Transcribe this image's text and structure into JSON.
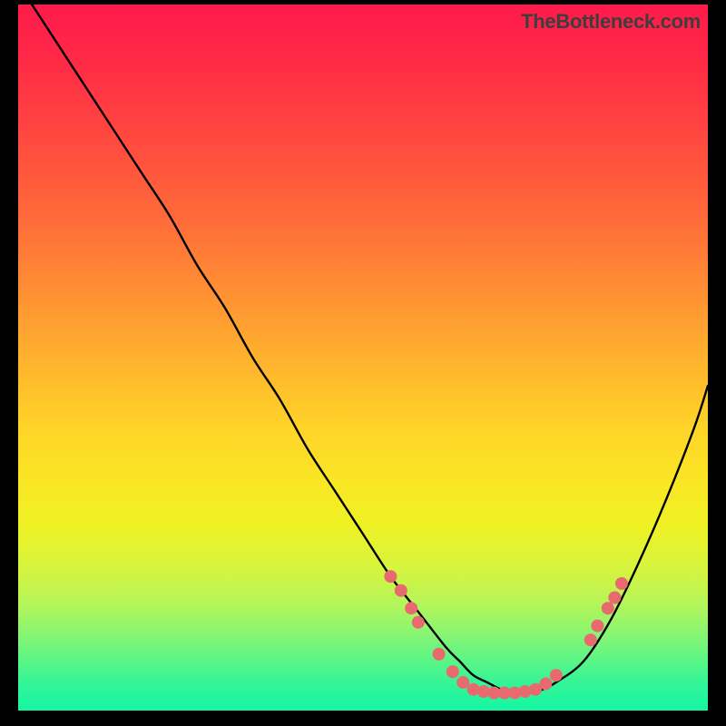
{
  "watermark": "TheBottleneck.com",
  "chart_data": {
    "type": "line",
    "title": "",
    "xlabel": "",
    "ylabel": "",
    "xlim": [
      0,
      100
    ],
    "ylim": [
      0,
      100
    ],
    "series": [
      {
        "name": "curve",
        "x": [
          2,
          6,
          10,
          14,
          18,
          22,
          26,
          30,
          34,
          38,
          42,
          46,
          50,
          54,
          58,
          62,
          64,
          66,
          68,
          70,
          72,
          74,
          76,
          78,
          82,
          86,
          90,
          94,
          98,
          100
        ],
        "y": [
          100,
          94,
          88,
          82,
          76,
          70,
          63,
          57,
          50,
          44,
          37,
          31,
          25,
          19,
          14,
          9,
          7,
          5,
          4,
          3,
          2.5,
          2.5,
          3,
          4,
          7,
          13,
          21,
          30,
          40,
          46
        ]
      }
    ],
    "markers": {
      "name": "dots",
      "color": "#e86a6f",
      "points": [
        {
          "x": 54,
          "y": 19
        },
        {
          "x": 55.5,
          "y": 17
        },
        {
          "x": 57,
          "y": 14.5
        },
        {
          "x": 58,
          "y": 12.5
        },
        {
          "x": 61,
          "y": 8
        },
        {
          "x": 63,
          "y": 5.5
        },
        {
          "x": 64.5,
          "y": 4
        },
        {
          "x": 66,
          "y": 3
        },
        {
          "x": 67.5,
          "y": 2.7
        },
        {
          "x": 69,
          "y": 2.5
        },
        {
          "x": 70.5,
          "y": 2.5
        },
        {
          "x": 72,
          "y": 2.5
        },
        {
          "x": 73.5,
          "y": 2.7
        },
        {
          "x": 75,
          "y": 3
        },
        {
          "x": 76.5,
          "y": 3.8
        },
        {
          "x": 78,
          "y": 5
        },
        {
          "x": 83,
          "y": 10
        },
        {
          "x": 84,
          "y": 12
        },
        {
          "x": 85.5,
          "y": 14.5
        },
        {
          "x": 86.5,
          "y": 16
        },
        {
          "x": 87.5,
          "y": 18
        }
      ]
    }
  }
}
